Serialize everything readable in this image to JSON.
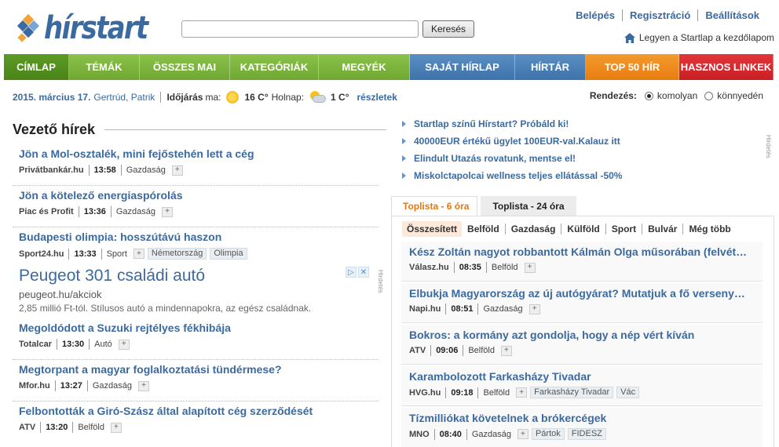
{
  "header": {
    "logo_text": "hírstart",
    "search": {
      "value": "",
      "placeholder": "",
      "button_label": "Keresés"
    },
    "top_links": [
      "Belépés",
      "Regisztráció",
      "Beállítások"
    ],
    "startlap_label": "Legyen a Startlap a kezdőlapom"
  },
  "nav": [
    {
      "label": "CÍMLAP",
      "color": "green",
      "active": true
    },
    {
      "label": "TÉMÁK",
      "color": "green"
    },
    {
      "label": "ÖSSZES MAI",
      "color": "green"
    },
    {
      "label": "KATEGÓRIÁK",
      "color": "green"
    },
    {
      "label": "MEGYÉK",
      "color": "green"
    },
    {
      "label": "SAJÁT HÍRLAP",
      "color": "blue"
    },
    {
      "label": "HÍRTÁR",
      "color": "blue"
    },
    {
      "label": "TOP 50 HÍR",
      "color": "orange"
    },
    {
      "label": "HASZNOS LINKEK",
      "color": "red"
    }
  ],
  "infobar": {
    "date": "2015. március 17.",
    "names": "Gertrúd, Patrik",
    "weather_label": "Időjárás",
    "today_label": "ma:",
    "today_temp": "16 C°",
    "tomorrow_label": "Holnap:",
    "tomorrow_temp": "1 C°",
    "more_link": "részletek",
    "sort_label": "Rendezés:",
    "sort_options": [
      {
        "label": "komolyan",
        "selected": true
      },
      {
        "label": "könnyedén",
        "selected": false
      }
    ]
  },
  "leading_news": {
    "title": "Vezető hírek",
    "items": [
      {
        "title": "Jön a Mol-osztalék, mini fejőstehén lett a cég",
        "source": "Privátbankár.hu",
        "time": "13:58",
        "category": "Gazdaság",
        "tags": []
      },
      {
        "title": "Jön a kötelező energiaspórolás",
        "source": "Piac és Profit",
        "time": "13:36",
        "category": "Gazdaság",
        "tags": []
      },
      {
        "title": "Budapesti olimpia: hosszútávú haszon",
        "source": "Sport24.hu",
        "time": "13:33",
        "category": "Sport",
        "tags": [
          "Németország",
          "Olimpia"
        ]
      }
    ],
    "items_after_ad": [
      {
        "title": "Megoldódott a Suzuki rejtélyes fékhibája",
        "source": "Totalcar",
        "time": "13:30",
        "category": "Autó",
        "tags": []
      },
      {
        "title": "Megtorpant a magyar foglalkoztatási tündérmese?",
        "source": "Mfor.hu",
        "time": "13:27",
        "category": "Gazdaság",
        "tags": []
      },
      {
        "title": "Felbontották a Giró-Szász által alapított cég szerződését",
        "source": "ATV",
        "time": "13:20",
        "category": "Belföld",
        "tags": []
      }
    ]
  },
  "ad": {
    "title": "Peugeot 301 családi autó",
    "url": "peugeot.hu/akciok",
    "description": "2,85 millió Ft-tól. Stílusos autó a mindennapokra, az egész családnak.",
    "side_label": "Hirdetés"
  },
  "promo": {
    "links": [
      "Startlap színű Hírstart? Próbáld ki!",
      "40000EUR értékű ügylet 100EUR-val.Kalauz itt",
      "Elindult Utazás rovatunk, mentse el!",
      "Miskolctapolcai wellness teljes ellátással -50%"
    ],
    "side_label": "Hirdetés"
  },
  "toplist": {
    "tabs": [
      {
        "label": "Toplista - 6 óra",
        "active": true
      },
      {
        "label": "Toplista - 24 óra",
        "active": false
      }
    ],
    "subtabs": [
      "Összesített",
      "Belföld",
      "Gazdaság",
      "Külföld",
      "Sport",
      "Bulvár",
      "Még több"
    ],
    "items": [
      {
        "title": "Kész Zoltán nagyot robbantott Kálmán Olga műsorában (felvét…",
        "source": "Válasz.hu",
        "time": "08:35",
        "category": "Belföld",
        "tags": []
      },
      {
        "title": "Elbukja Magyarország az új autógyárat? Mutatjuk a fő verseny…",
        "source": "Napi.hu",
        "time": "08:51",
        "category": "Gazdaság",
        "tags": []
      },
      {
        "title": "Bokros: a kormány azt gondolja, hogy a nép vért kíván",
        "source": "ATV",
        "time": "09:06",
        "category": "Belföld",
        "tags": []
      },
      {
        "title": "Karambolozott Farkasházy Tivadar",
        "source": "HVG.hu",
        "time": "09:18",
        "category": "Belföld",
        "tags": [
          "Farkasházy Tivadar",
          "Vác"
        ]
      },
      {
        "title": "Tízmilliókat követelnek a brókercégek",
        "source": "MNO",
        "time": "08:40",
        "category": "Gazdaság",
        "tags": [
          "Pártok",
          "FIDESZ"
        ]
      }
    ]
  },
  "colors": {
    "link_blue": "#3b6aa0",
    "nav_green": "#6fa733",
    "nav_blue": "#3d72aa",
    "nav_orange": "#e87d10",
    "nav_red": "#c81f24",
    "tab_active_orange": "#e8770e"
  }
}
